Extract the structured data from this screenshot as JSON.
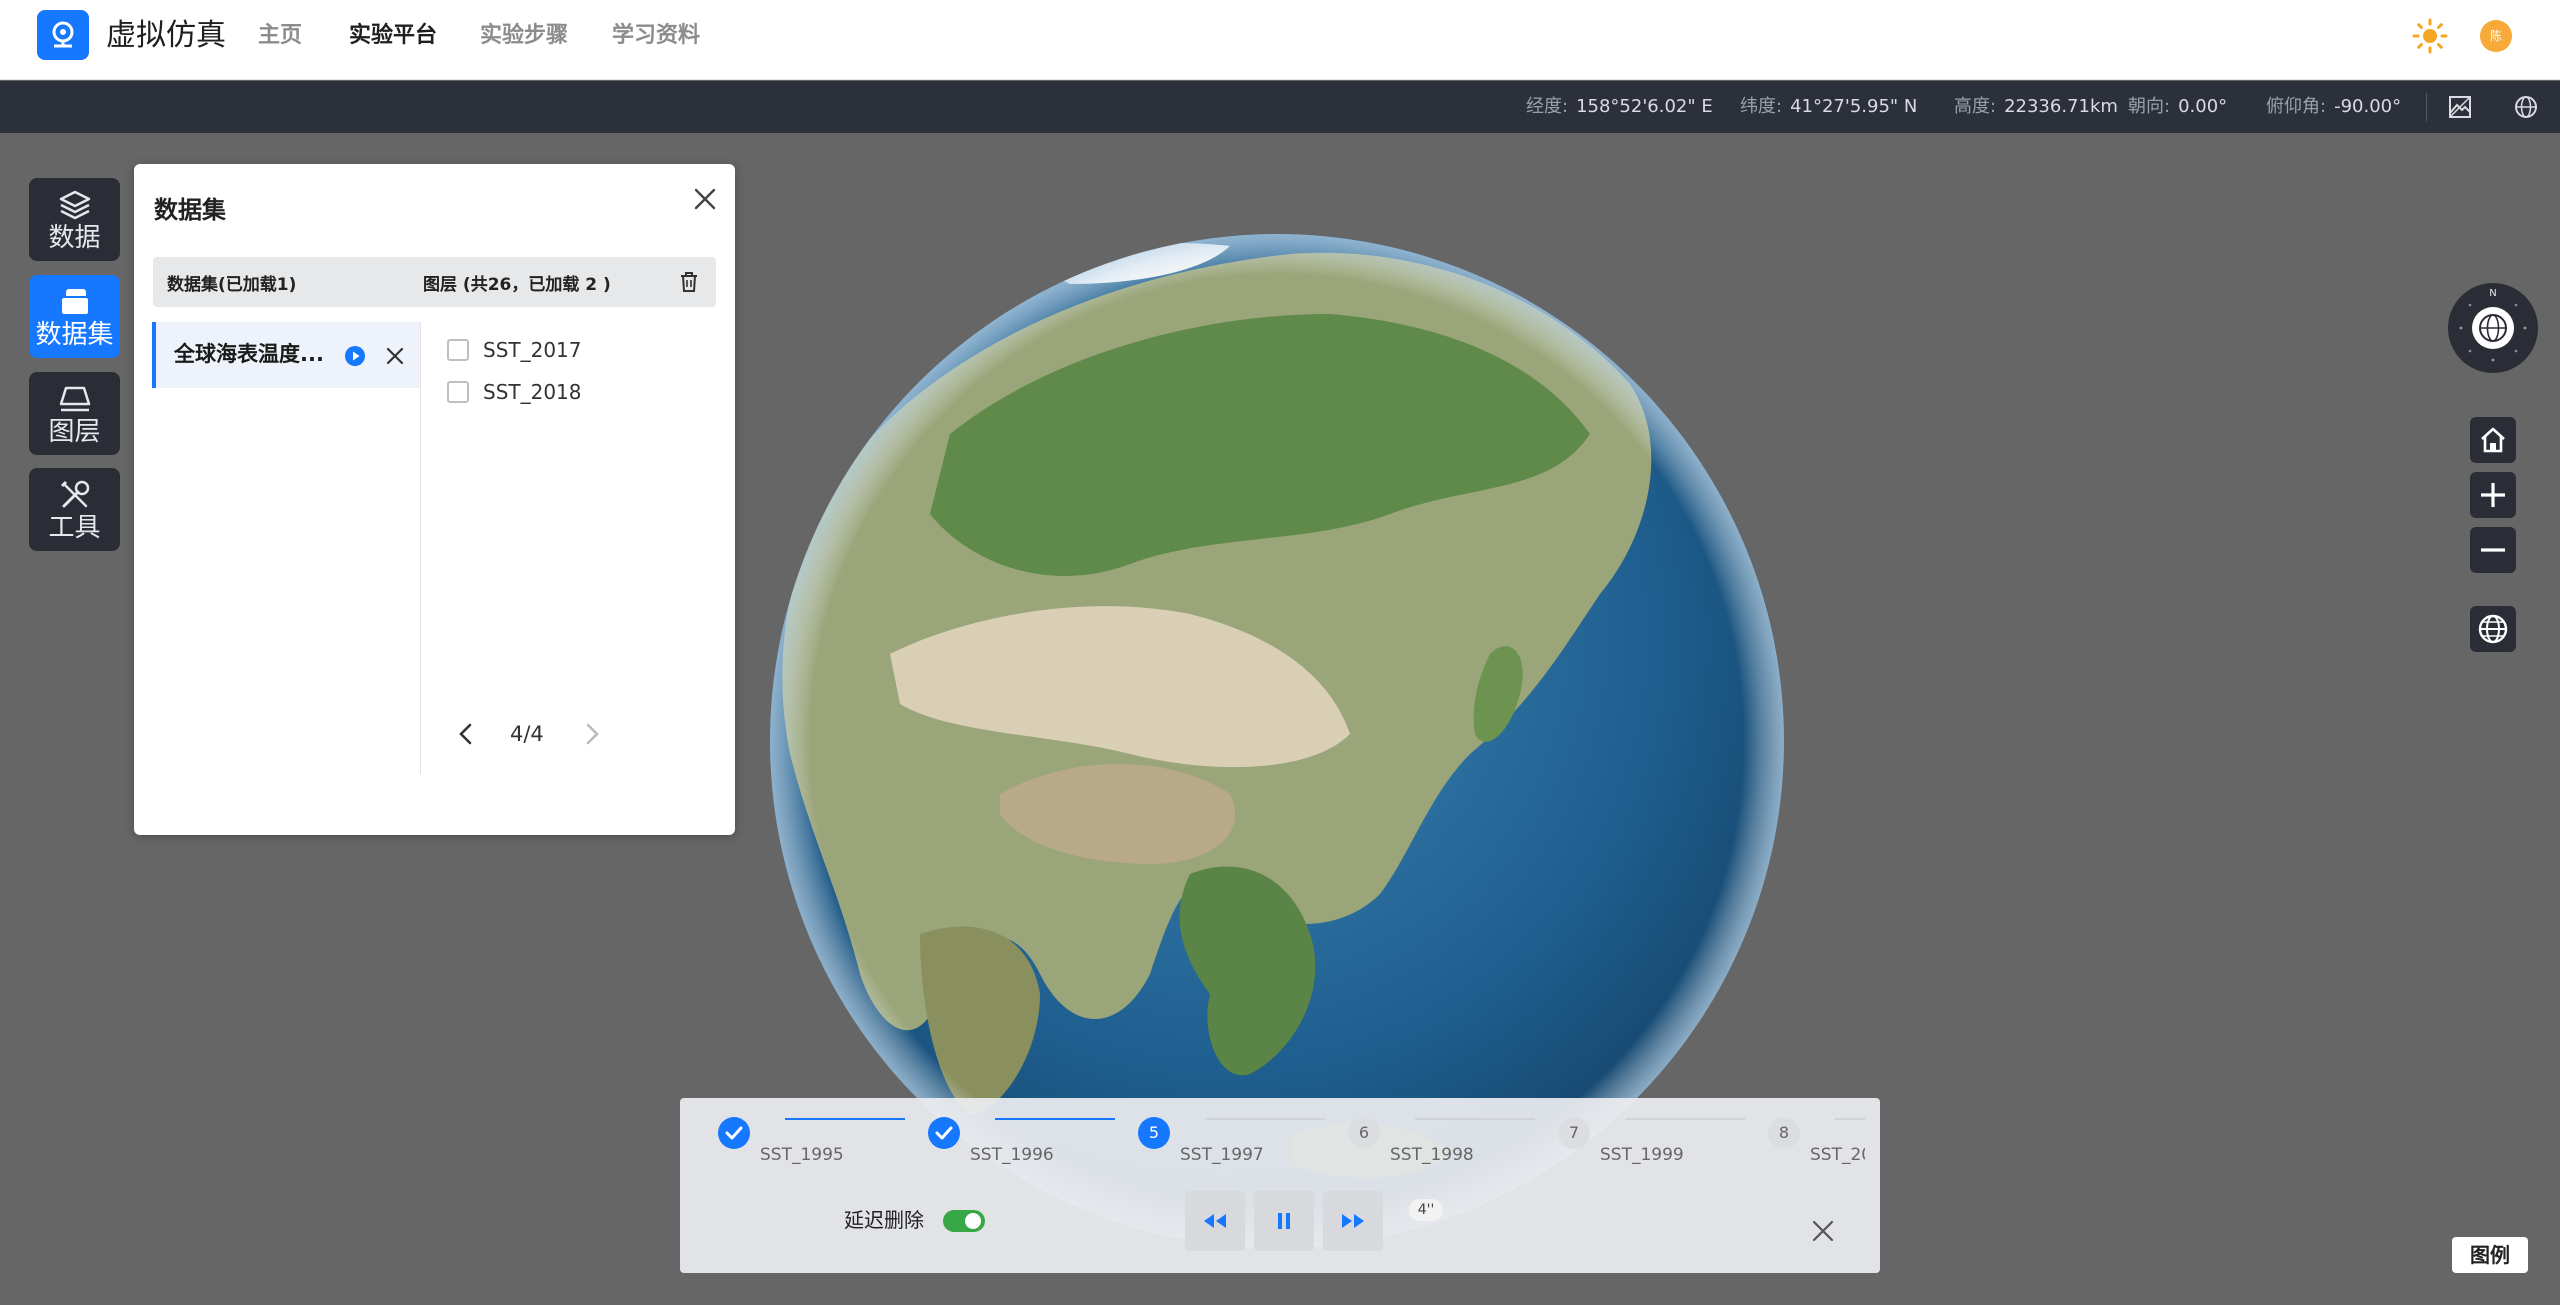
{
  "app": {
    "title": "虚拟仿真",
    "brand_color": "#1677ff",
    "nav": [
      {
        "label": "主页",
        "active": false
      },
      {
        "label": "实验平台",
        "active": true
      },
      {
        "label": "实验步骤",
        "active": false
      },
      {
        "label": "学习资料",
        "active": false
      }
    ],
    "theme_icon": "sun-icon",
    "avatar_text": "陈"
  },
  "status_bar": {
    "longitude_label": "经度:",
    "longitude": "158°52'6.02\" E",
    "latitude_label": "纬度:",
    "latitude": "41°27'5.95\" N",
    "height_label": "高度:",
    "height": "22336.71km",
    "heading_label": "朝向:",
    "heading": "0.00°",
    "pitch_label": "俯仰角:",
    "pitch": "-90.00°",
    "icons": [
      "map-picture-icon",
      "globe-icon"
    ]
  },
  "left_rail": [
    {
      "label": "数据",
      "icon": "layers-icon",
      "active": false
    },
    {
      "label": "数据集",
      "icon": "dataset-icon",
      "active": true
    },
    {
      "label": "图层",
      "icon": "layer-plane-icon",
      "active": false
    },
    {
      "label": "工具",
      "icon": "tools-icon",
      "active": false
    }
  ],
  "dataset_panel": {
    "title": "数据集",
    "header_datasets": "数据集(已加载1)",
    "header_layers": "图层 (共26，已加载 2 )",
    "dataset_item": "全球海表温度...",
    "layers": [
      {
        "label": "SST_2017",
        "checked": false
      },
      {
        "label": "SST_2018",
        "checked": false
      }
    ],
    "pager": "4/4"
  },
  "map_controls": {
    "compass_letter": "N",
    "buttons": [
      "home-icon",
      "zoom-in-icon",
      "zoom-out-icon",
      "globe-icon"
    ]
  },
  "timeline": {
    "steps": [
      {
        "marker": "",
        "label": "SST_1995",
        "state": "done"
      },
      {
        "marker": "",
        "label": "SST_1996",
        "state": "done"
      },
      {
        "marker": "5",
        "label": "SST_1997",
        "state": "current"
      },
      {
        "marker": "6",
        "label": "SST_1998",
        "state": "todo"
      },
      {
        "marker": "7",
        "label": "SST_1999",
        "state": "todo"
      },
      {
        "marker": "8",
        "label": "SST_20",
        "state": "todo"
      }
    ],
    "delay_delete_label": "延迟删除",
    "delay_delete_on": true,
    "speed": "4''"
  },
  "legend_label": "图例"
}
